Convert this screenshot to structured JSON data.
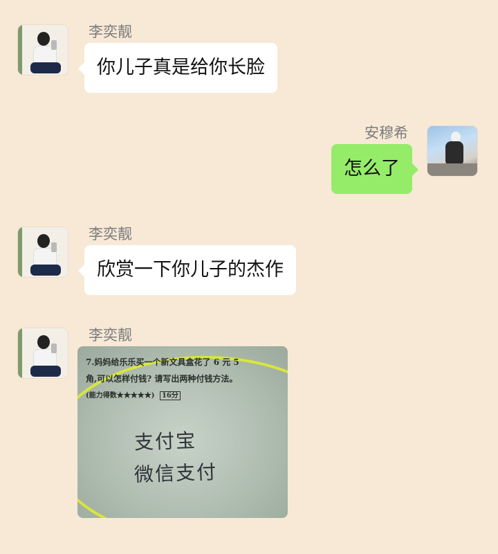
{
  "chat": {
    "messages": [
      {
        "sender": "李奕靓",
        "side": "left",
        "text": "你儿子真是给你长脸"
      },
      {
        "sender": "安穆希",
        "side": "right",
        "text": "怎么了"
      },
      {
        "sender": "李奕靓",
        "side": "left",
        "text": "欣赏一下你儿子的杰作"
      },
      {
        "sender": "李奕靓",
        "side": "left",
        "type": "image",
        "image": {
          "printed_line1": "7.妈妈给乐乐买一个新文具盒花了 6 元 5",
          "printed_line2": "角,可以怎样付钱? 请写出两种付钱方法。",
          "printed_line3": "(能力得数★★★★★)",
          "score": "16分",
          "answer_line1": "支付宝",
          "answer_line2": "微信支付"
        }
      }
    ]
  },
  "colors": {
    "background": "#f7e9d6",
    "bubble_left": "#ffffff",
    "bubble_right": "#95ec69",
    "name_text": "#7b7b7b"
  },
  "icons": {
    "left_avatar": "girl-avatar-icon",
    "right_avatar": "boy-avatar-icon"
  }
}
